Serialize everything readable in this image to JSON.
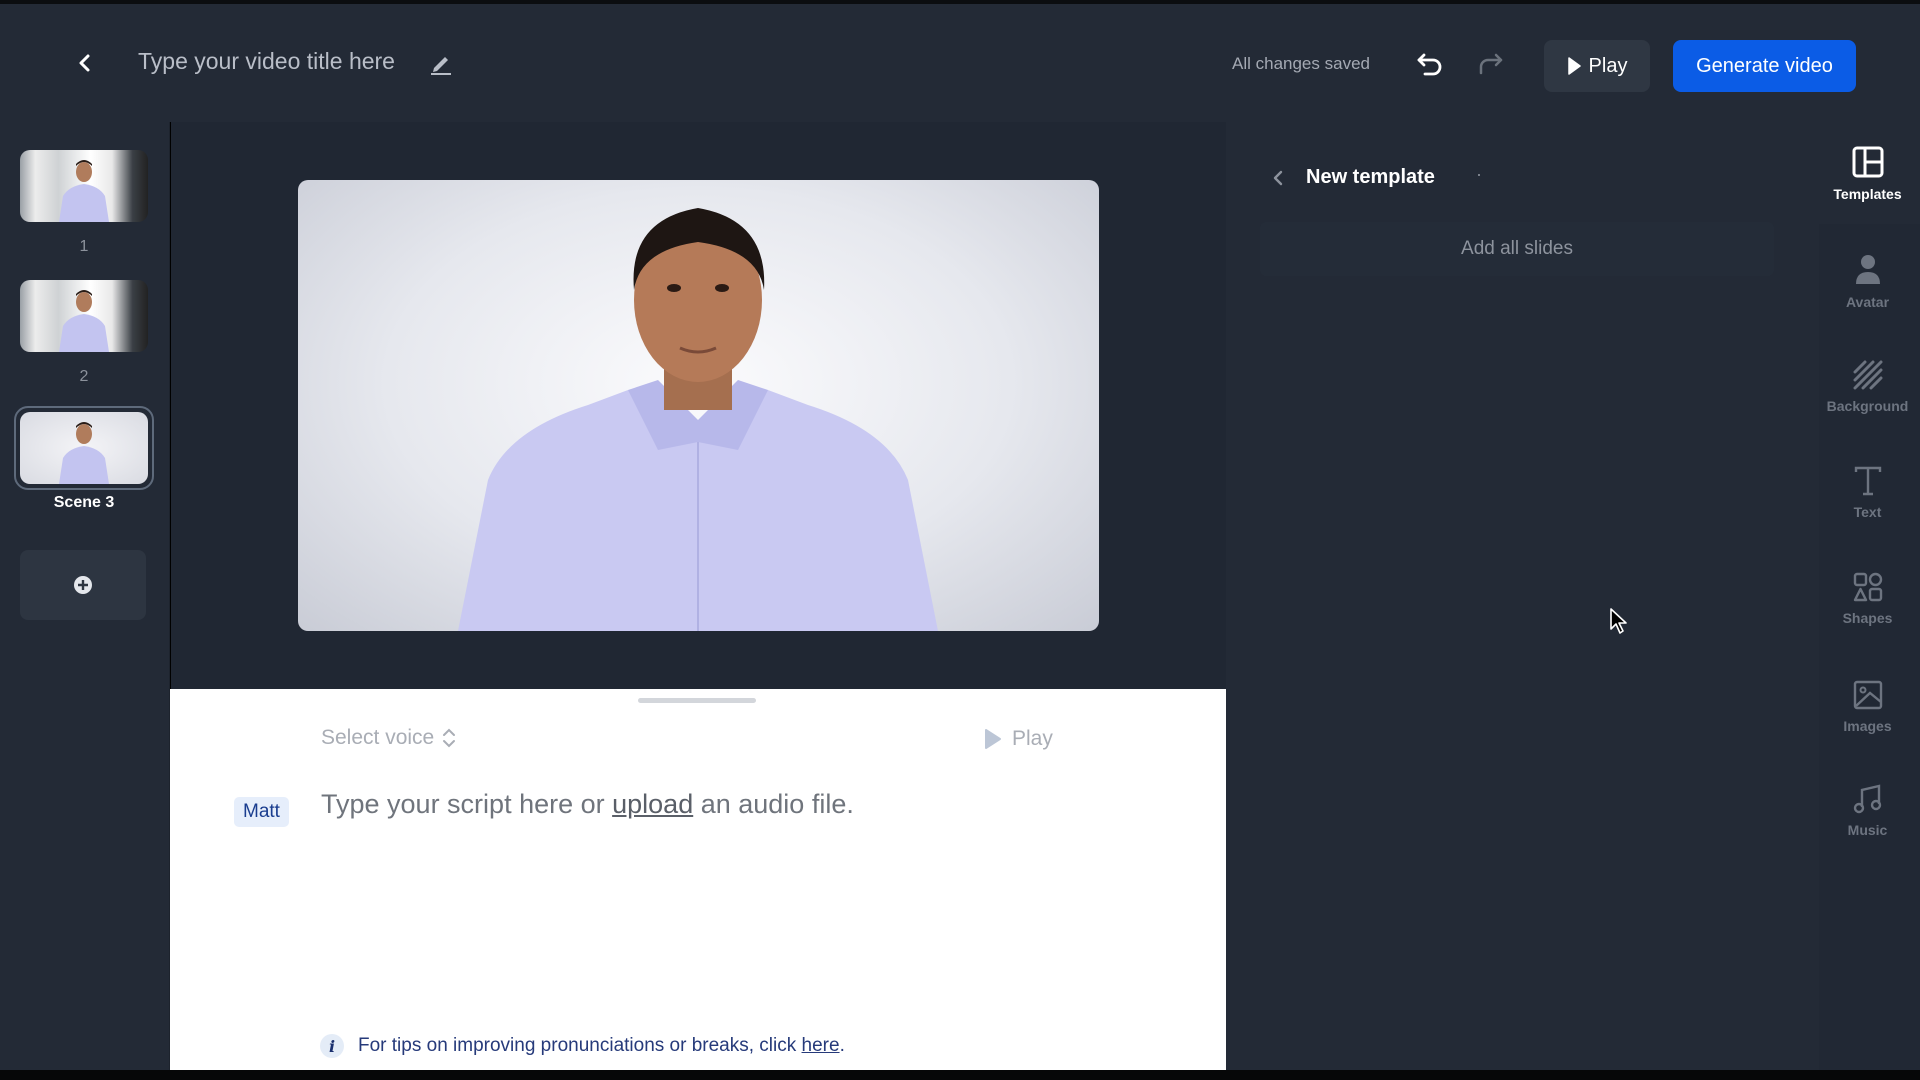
{
  "header": {
    "title_placeholder": "Type your video title here",
    "save_status": "All changes saved",
    "play_label": "Play",
    "generate_label": "Generate video",
    "colors": {
      "accent": "#0b5ce6",
      "background": "#232a36"
    }
  },
  "scenes": [
    {
      "label": "1",
      "background": "office"
    },
    {
      "label": "2",
      "background": "office"
    },
    {
      "label": "Scene 3",
      "background": "studio",
      "active": true
    }
  ],
  "script": {
    "voice_placeholder": "Select voice",
    "play_label": "Play",
    "speaker": "Matt",
    "placeholder_prefix": "Type your script here or ",
    "placeholder_link": "upload",
    "placeholder_suffix": " an audio file.",
    "tip_prefix": "For tips on improving pronunciations or breaks, click ",
    "tip_link": "here",
    "tip_suffix": "."
  },
  "right_panel": {
    "title": "New template",
    "add_all_label": "Add all slides"
  },
  "rail": [
    {
      "label": "Templates",
      "icon": "templates-icon",
      "active": true
    },
    {
      "label": "Avatar",
      "icon": "avatar-icon"
    },
    {
      "label": "Background",
      "icon": "background-icon"
    },
    {
      "label": "Text",
      "icon": "text-icon"
    },
    {
      "label": "Shapes",
      "icon": "shapes-icon"
    },
    {
      "label": "Images",
      "icon": "images-icon"
    },
    {
      "label": "Music",
      "icon": "music-icon"
    }
  ]
}
